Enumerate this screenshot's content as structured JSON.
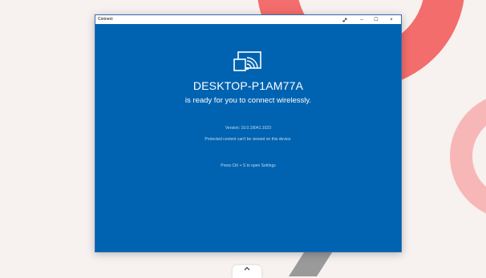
{
  "window": {
    "title": "Connect",
    "controls": {
      "compact_icon": "expand-arrow-icon",
      "minimize_label": "–",
      "maximize_label": "☐",
      "close_label": "×"
    }
  },
  "content": {
    "icon": "wireless-cast-icon",
    "device_name": "DESKTOP-P1AM77A",
    "ready_text": "is ready for you to connect wirelessly.",
    "version_text": "Version: 10.0.19041.1023",
    "protected_text": "Protected content can't be viewed on this device.",
    "settings_hint": "Press Ctrl + S to open Settings"
  },
  "taskbar": {
    "show_icons_icon": "chevron-up-icon"
  },
  "colors": {
    "window_bg": "#0063b1",
    "wallpaper_bg": "#f7f1f0",
    "accent_coral": "#f26d6b",
    "accent_pink": "#f7b7b6",
    "accent_gray": "#9a9a9a"
  }
}
